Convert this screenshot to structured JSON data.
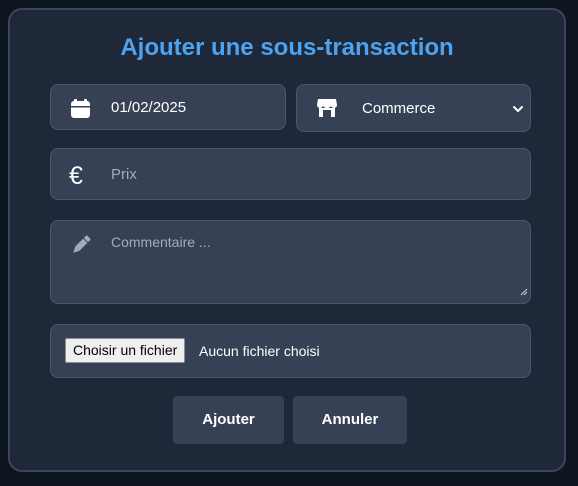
{
  "modal": {
    "title": "Ajouter une sous-transaction"
  },
  "form": {
    "date": {
      "value": "01/02/2025",
      "icon": "calendar-icon"
    },
    "category": {
      "value": "Commerce",
      "icon": "store-icon"
    },
    "price": {
      "placeholder": "Prix",
      "icon": "euro-icon",
      "symbol": "€"
    },
    "comment": {
      "placeholder": "Commentaire ...",
      "icon": "pencil-icon"
    },
    "file": {
      "button_label": "Choisir un fichier",
      "status": "Aucun fichier choisi"
    }
  },
  "actions": {
    "submit_label": "Ajouter",
    "cancel_label": "Annuler"
  },
  "colors": {
    "title": "#4da3f0",
    "panel": "#1f2838",
    "field": "#374156",
    "background": "#0d1520"
  }
}
